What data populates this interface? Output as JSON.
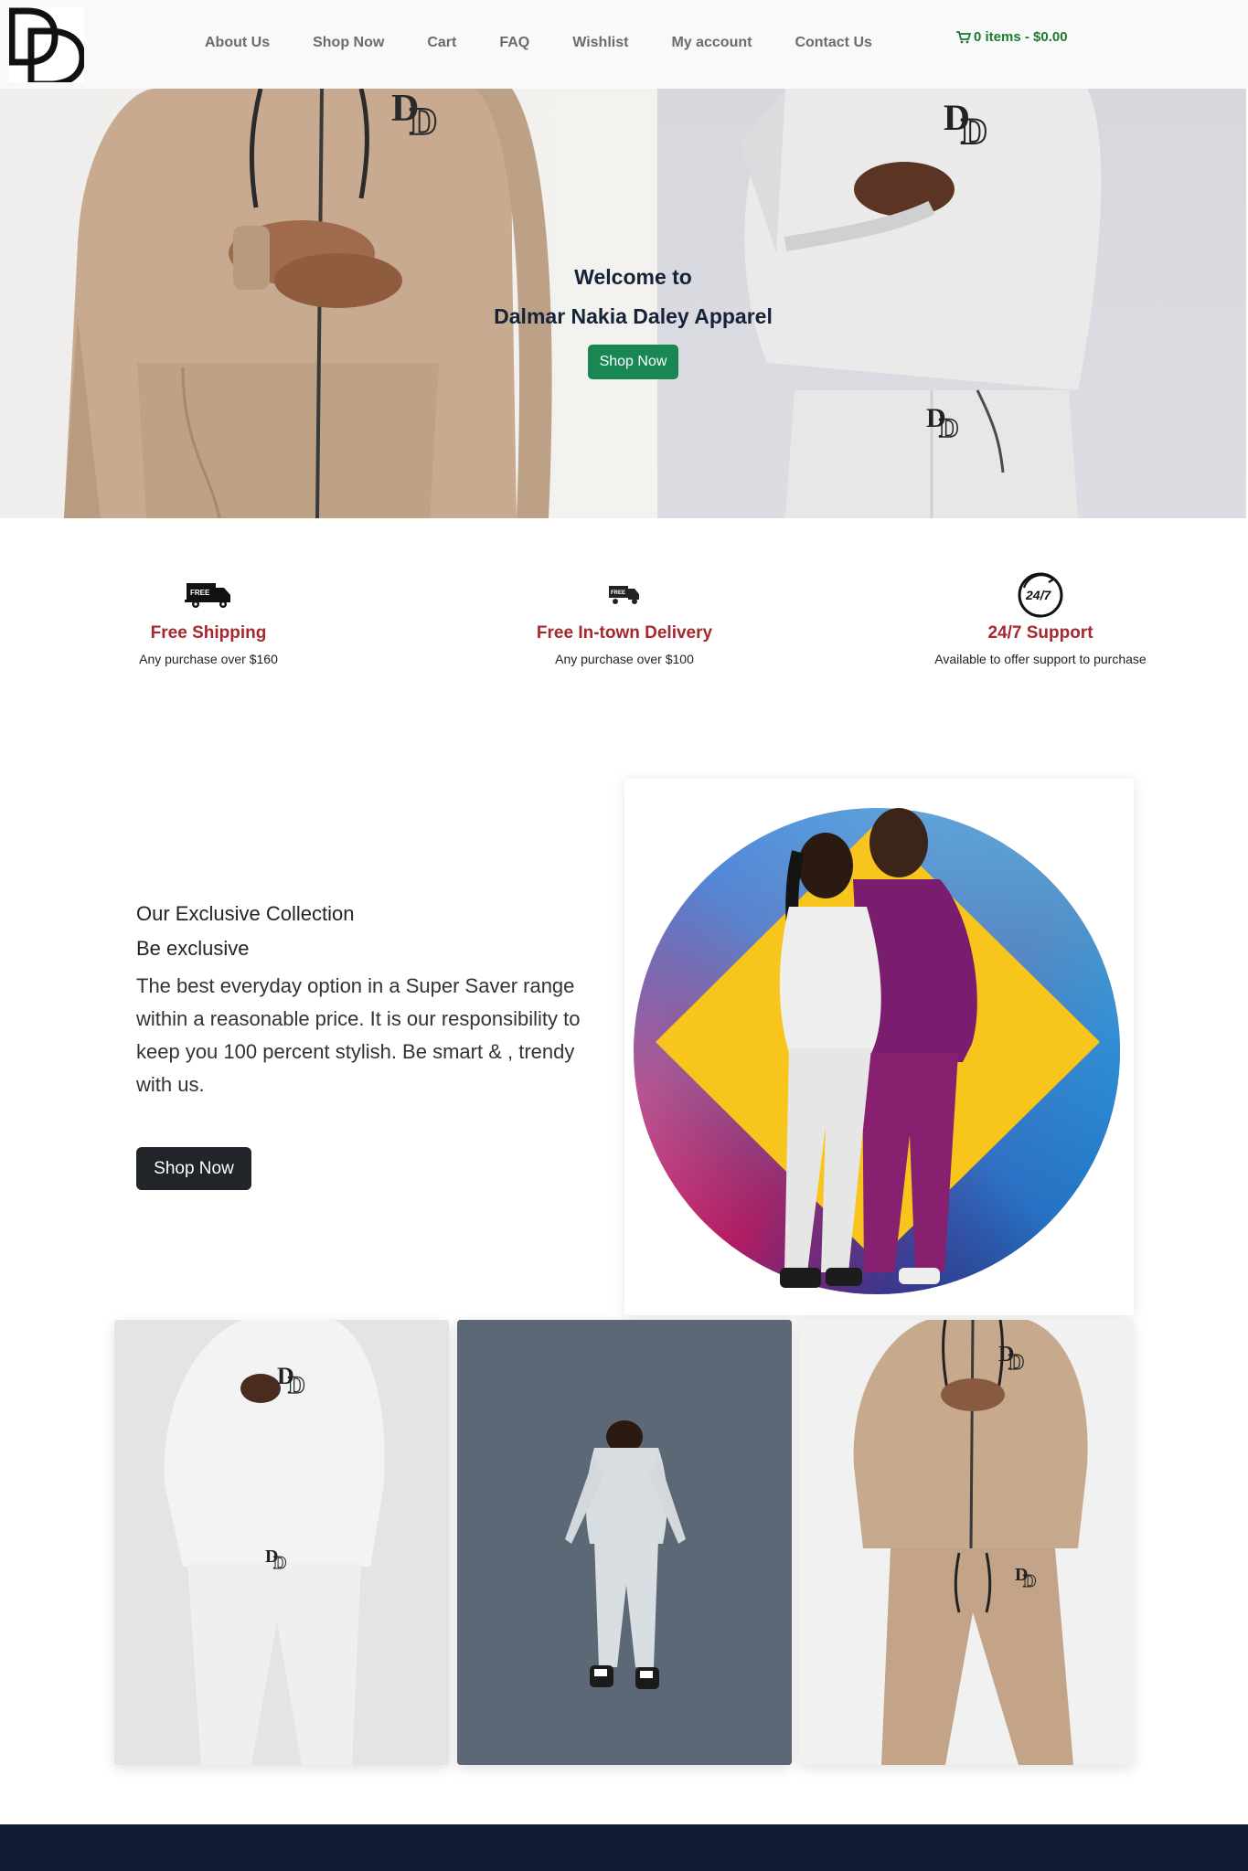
{
  "nav": {
    "logo_icon": "dd-monogram-logo",
    "items": [
      {
        "label": "About Us"
      },
      {
        "label": "Shop Now"
      },
      {
        "label": "Cart"
      },
      {
        "label": "FAQ"
      },
      {
        "label": "Wishlist"
      },
      {
        "label": "My account"
      },
      {
        "label": "Contact Us"
      }
    ],
    "cart_icon": "shopping-cart-icon",
    "cart_label": "0 items - $0.00",
    "cart_color": "#1f7a2e"
  },
  "hero": {
    "welcome": "Welcome to",
    "brand": "Dalmar Nakia Daley Apparel",
    "button": "Shop Now",
    "button_color": "#198754"
  },
  "features": [
    {
      "icon": "free-shipping-truck-icon",
      "title": "Free Shipping",
      "desc": "Any purchase over $160"
    },
    {
      "icon": "free-delivery-truck-icon",
      "title": "Free In-town Delivery",
      "desc": "Any purchase over $100"
    },
    {
      "icon": "support-24-7-icon",
      "title": "24/7 Support",
      "desc": "Available to offer support to purchase"
    }
  ],
  "feature_title_color": "#a5282e",
  "collection": {
    "heading": "Our Exclusive Collection",
    "subheading": "Be exclusive",
    "body": "The best everyday option in a Super Saver range within a reasonable price. It is our responsibility to keep you 100 percent stylish. Be smart & , trendy with us.",
    "button": "Shop Now"
  },
  "products": [
    {
      "name": "white-tracksuit"
    },
    {
      "name": "grey-tracksuit-jump"
    },
    {
      "name": "beige-tracksuit"
    }
  ],
  "footer_color": "#0e1b33"
}
